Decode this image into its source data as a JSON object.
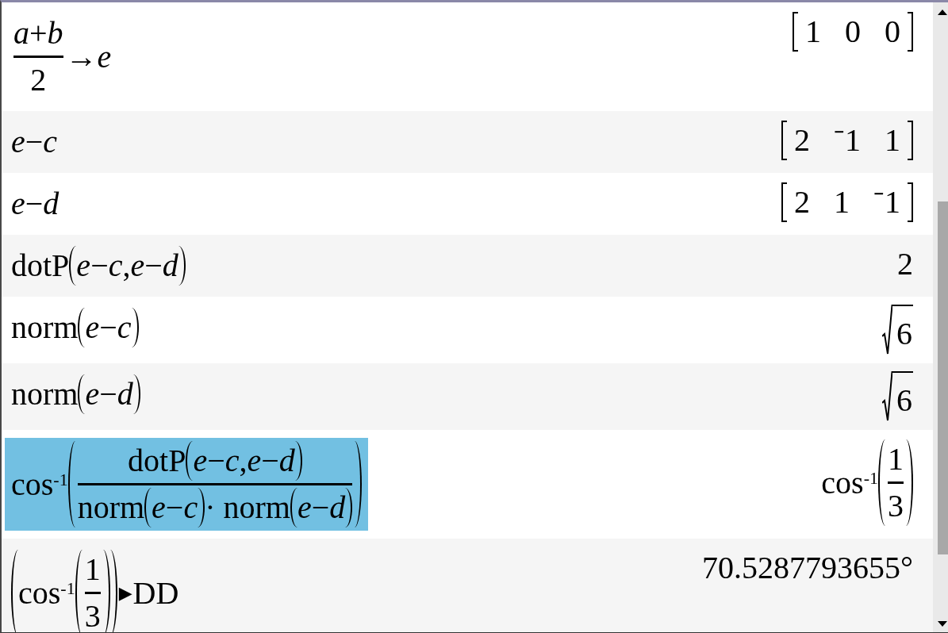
{
  "history": [
    {
      "selected": false,
      "input": [
        {
          "kind": "frac",
          "num": [
            {
              "kind": "text",
              "text": "*a*+*b*"
            }
          ],
          "den": [
            {
              "kind": "text",
              "text": "2"
            }
          ]
        },
        {
          "kind": "text",
          "text": "→*e*"
        }
      ],
      "output": [
        {
          "kind": "matrix",
          "cells": [
            "1",
            "0",
            "0"
          ]
        }
      ]
    },
    {
      "selected": false,
      "input": [
        {
          "kind": "text",
          "text": "*e*−*c*"
        }
      ],
      "output": [
        {
          "kind": "matrix",
          "cells": [
            "2",
            "⁻1",
            "1"
          ]
        }
      ]
    },
    {
      "selected": false,
      "input": [
        {
          "kind": "text",
          "text": "*e*−*d*"
        }
      ],
      "output": [
        {
          "kind": "matrix",
          "cells": [
            "2",
            "1",
            "⁻1"
          ]
        }
      ]
    },
    {
      "selected": false,
      "input": [
        {
          "kind": "text",
          "text": "dotP"
        },
        {
          "kind": "paren",
          "body": [
            {
              "kind": "text",
              "text": "*e*−*c*,*e*−*d*"
            }
          ]
        }
      ],
      "output": [
        {
          "kind": "text",
          "text": "2"
        }
      ]
    },
    {
      "selected": false,
      "input": [
        {
          "kind": "text",
          "text": "norm"
        },
        {
          "kind": "paren",
          "body": [
            {
              "kind": "text",
              "text": "*e*−*c*"
            }
          ]
        }
      ],
      "output": [
        {
          "kind": "sqrt",
          "body": [
            {
              "kind": "text",
              "text": "6"
            }
          ]
        }
      ]
    },
    {
      "selected": false,
      "input": [
        {
          "kind": "text",
          "text": "norm"
        },
        {
          "kind": "paren",
          "body": [
            {
              "kind": "text",
              "text": "*e*−*d*"
            }
          ]
        }
      ],
      "output": [
        {
          "kind": "sqrt",
          "body": [
            {
              "kind": "text",
              "text": "6"
            }
          ]
        }
      ]
    },
    {
      "selected": true,
      "input": [
        {
          "kind": "text",
          "text": "cos$^{-1}$"
        },
        {
          "kind": "paren",
          "body": [
            {
              "kind": "frac",
              "num": [
                {
                  "kind": "text",
                  "text": "dotP"
                },
                {
                  "kind": "paren",
                  "body": [
                    {
                      "kind": "text",
                      "text": "*e*−*c*,*e*−*d*"
                    }
                  ]
                }
              ],
              "den": [
                {
                  "kind": "text",
                  "text": "norm"
                },
                {
                  "kind": "paren",
                  "body": [
                    {
                      "kind": "text",
                      "text": "*e*−*c*"
                    }
                  ]
                },
                {
                  "kind": "text",
                  "text": "· norm"
                },
                {
                  "kind": "paren",
                  "body": [
                    {
                      "kind": "text",
                      "text": "*e*−*d*"
                    }
                  ]
                }
              ]
            }
          ]
        }
      ],
      "output": [
        {
          "kind": "text",
          "text": "cos$^{-1}$"
        },
        {
          "kind": "paren",
          "body": [
            {
              "kind": "frac",
              "num": [
                {
                  "kind": "text",
                  "text": "1"
                }
              ],
              "den": [
                {
                  "kind": "text",
                  "text": "3"
                }
              ]
            }
          ]
        }
      ]
    },
    {
      "selected": false,
      "input": [
        {
          "kind": "paren",
          "body": [
            {
              "kind": "text",
              "text": "cos$^{-1}$"
            },
            {
              "kind": "paren",
              "body": [
                {
                  "kind": "frac",
                  "num": [
                    {
                      "kind": "text",
                      "text": "1"
                    }
                  ],
                  "den": [
                    {
                      "kind": "text",
                      "text": "3"
                    }
                  ]
                }
              ]
            }
          ]
        },
        {
          "kind": "symbol",
          "text": "▶"
        },
        {
          "kind": "text",
          "text": "DD"
        }
      ],
      "output": [
        {
          "kind": "text",
          "text": "70.5287793655°"
        }
      ]
    }
  ]
}
